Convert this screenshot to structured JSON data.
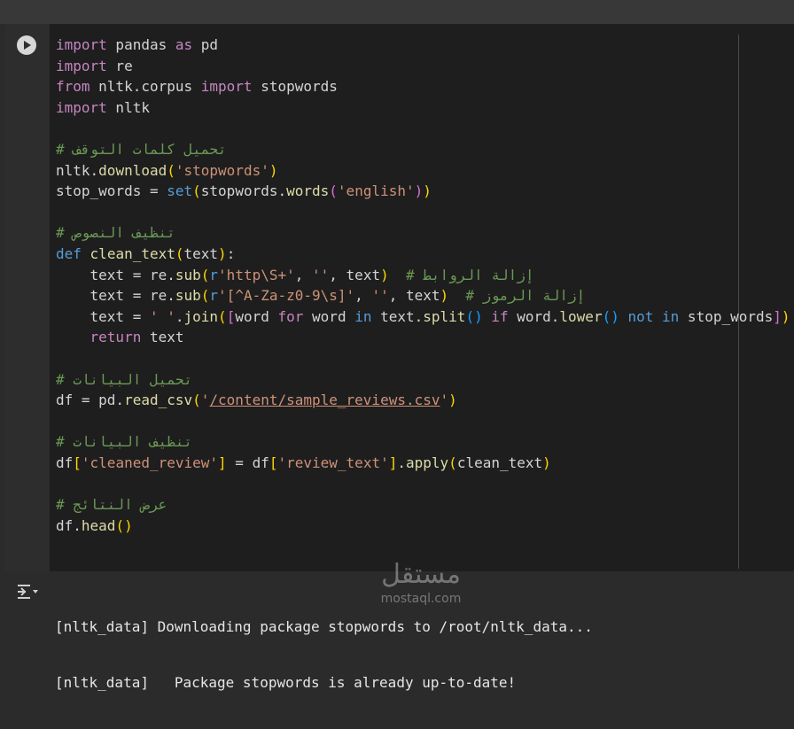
{
  "code_lines": [
    {
      "segs": [
        {
          "t": "import",
          "c": "kw2"
        },
        {
          "t": " pandas "
        },
        {
          "t": "as",
          "c": "kw2"
        },
        {
          "t": " pd"
        }
      ]
    },
    {
      "segs": [
        {
          "t": "import",
          "c": "kw2"
        },
        {
          "t": " re"
        }
      ]
    },
    {
      "segs": [
        {
          "t": "from",
          "c": "kw2"
        },
        {
          "t": " nltk.corpus "
        },
        {
          "t": "import",
          "c": "kw2"
        },
        {
          "t": " stopwords"
        }
      ]
    },
    {
      "segs": [
        {
          "t": "import",
          "c": "kw2"
        },
        {
          "t": " nltk"
        }
      ]
    },
    {
      "segs": []
    },
    {
      "segs": [
        {
          "t": "# تحميل كلمات التوقف",
          "c": "cm"
        }
      ]
    },
    {
      "segs": [
        {
          "t": "nltk."
        },
        {
          "t": "download",
          "c": "fn"
        },
        {
          "t": "(",
          "c": "bk1"
        },
        {
          "t": "'stopwords'",
          "c": "str"
        },
        {
          "t": ")",
          "c": "bk1"
        }
      ]
    },
    {
      "segs": [
        {
          "t": "stop_words = "
        },
        {
          "t": "set",
          "c": "kw"
        },
        {
          "t": "(",
          "c": "bk1"
        },
        {
          "t": "stopwords."
        },
        {
          "t": "words",
          "c": "fn"
        },
        {
          "t": "(",
          "c": "bk2"
        },
        {
          "t": "'english'",
          "c": "str"
        },
        {
          "t": ")",
          "c": "bk2"
        },
        {
          "t": ")",
          "c": "bk1"
        }
      ]
    },
    {
      "segs": []
    },
    {
      "segs": [
        {
          "t": "# تنظيف النصوص",
          "c": "cm"
        }
      ]
    },
    {
      "segs": [
        {
          "t": "def",
          "c": "kw"
        },
        {
          "t": " "
        },
        {
          "t": "clean_text",
          "c": "fn"
        },
        {
          "t": "(",
          "c": "bk1"
        },
        {
          "t": "text"
        },
        {
          "t": ")",
          "c": "bk1"
        },
        {
          "t": ":"
        }
      ]
    },
    {
      "segs": [
        {
          "t": "    text = re."
        },
        {
          "t": "sub",
          "c": "fn"
        },
        {
          "t": "(",
          "c": "bk1"
        },
        {
          "t": "r",
          "c": "kw"
        },
        {
          "t": "'http\\S+'",
          "c": "str"
        },
        {
          "t": ", "
        },
        {
          "t": "''",
          "c": "str"
        },
        {
          "t": ", text"
        },
        {
          "t": ")",
          "c": "bk1"
        },
        {
          "t": "  "
        },
        {
          "t": "# إزالة الروابط",
          "c": "cm"
        }
      ]
    },
    {
      "segs": [
        {
          "t": "    text = re."
        },
        {
          "t": "sub",
          "c": "fn"
        },
        {
          "t": "(",
          "c": "bk1"
        },
        {
          "t": "r",
          "c": "kw"
        },
        {
          "t": "'[^A-Za-z0-9\\s]'",
          "c": "str"
        },
        {
          "t": ", "
        },
        {
          "t": "''",
          "c": "str"
        },
        {
          "t": ", text"
        },
        {
          "t": ")",
          "c": "bk1"
        },
        {
          "t": "  "
        },
        {
          "t": "# إزالة الرموز",
          "c": "cm"
        }
      ]
    },
    {
      "segs": [
        {
          "t": "    text = "
        },
        {
          "t": "' '",
          "c": "str"
        },
        {
          "t": "."
        },
        {
          "t": "join",
          "c": "fn"
        },
        {
          "t": "(",
          "c": "bk1"
        },
        {
          "t": "[",
          "c": "bk2"
        },
        {
          "t": "word "
        },
        {
          "t": "for",
          "c": "kw2"
        },
        {
          "t": " word "
        },
        {
          "t": "in",
          "c": "kw"
        },
        {
          "t": " text."
        },
        {
          "t": "split",
          "c": "fn"
        },
        {
          "t": "()",
          "c": "bk3"
        },
        {
          "t": " "
        },
        {
          "t": "if",
          "c": "kw2"
        },
        {
          "t": " word."
        },
        {
          "t": "lower",
          "c": "fn"
        },
        {
          "t": "()",
          "c": "bk3"
        },
        {
          "t": " "
        },
        {
          "t": "not",
          "c": "kw"
        },
        {
          "t": " "
        },
        {
          "t": "in",
          "c": "kw"
        },
        {
          "t": " stop_words"
        },
        {
          "t": "]",
          "c": "bk2"
        },
        {
          "t": ")",
          "c": "bk1"
        }
      ]
    },
    {
      "segs": [
        {
          "t": "    "
        },
        {
          "t": "return",
          "c": "kw2"
        },
        {
          "t": " text"
        }
      ]
    },
    {
      "segs": []
    },
    {
      "segs": [
        {
          "t": "# تحميل البيانات",
          "c": "cm"
        }
      ]
    },
    {
      "segs": [
        {
          "t": "df = pd."
        },
        {
          "t": "read_csv",
          "c": "fn"
        },
        {
          "t": "(",
          "c": "bk1"
        },
        {
          "t": "'",
          "c": "str"
        },
        {
          "t": "/content/sample_reviews.csv",
          "c": "str ul"
        },
        {
          "t": "'",
          "c": "str"
        },
        {
          "t": ")",
          "c": "bk1"
        }
      ]
    },
    {
      "segs": []
    },
    {
      "segs": [
        {
          "t": "# تنظيف البيانات",
          "c": "cm"
        }
      ]
    },
    {
      "segs": [
        {
          "t": "df"
        },
        {
          "t": "[",
          "c": "bk1"
        },
        {
          "t": "'cleaned_review'",
          "c": "str"
        },
        {
          "t": "]",
          "c": "bk1"
        },
        {
          "t": " = df"
        },
        {
          "t": "[",
          "c": "bk1"
        },
        {
          "t": "'review_text'",
          "c": "str"
        },
        {
          "t": "]",
          "c": "bk1"
        },
        {
          "t": "."
        },
        {
          "t": "apply",
          "c": "fn"
        },
        {
          "t": "(",
          "c": "bk1"
        },
        {
          "t": "clean_text"
        },
        {
          "t": ")",
          "c": "bk1"
        }
      ]
    },
    {
      "segs": []
    },
    {
      "segs": [
        {
          "t": "# عرض النتائج",
          "c": "cm"
        }
      ]
    },
    {
      "segs": [
        {
          "t": "df."
        },
        {
          "t": "head",
          "c": "fn"
        },
        {
          "t": "()",
          "c": "bk1"
        }
      ]
    }
  ],
  "output_lines": [
    "[nltk_data] Downloading package stopwords to /root/nltk_data...",
    "[nltk_data]   Package stopwords is already up-to-date!"
  ],
  "icons": {
    "run": "play-icon",
    "output": "output-settings-icon"
  },
  "watermark": {
    "text_ar": "مستقل",
    "text_en": "mostaql.com"
  }
}
